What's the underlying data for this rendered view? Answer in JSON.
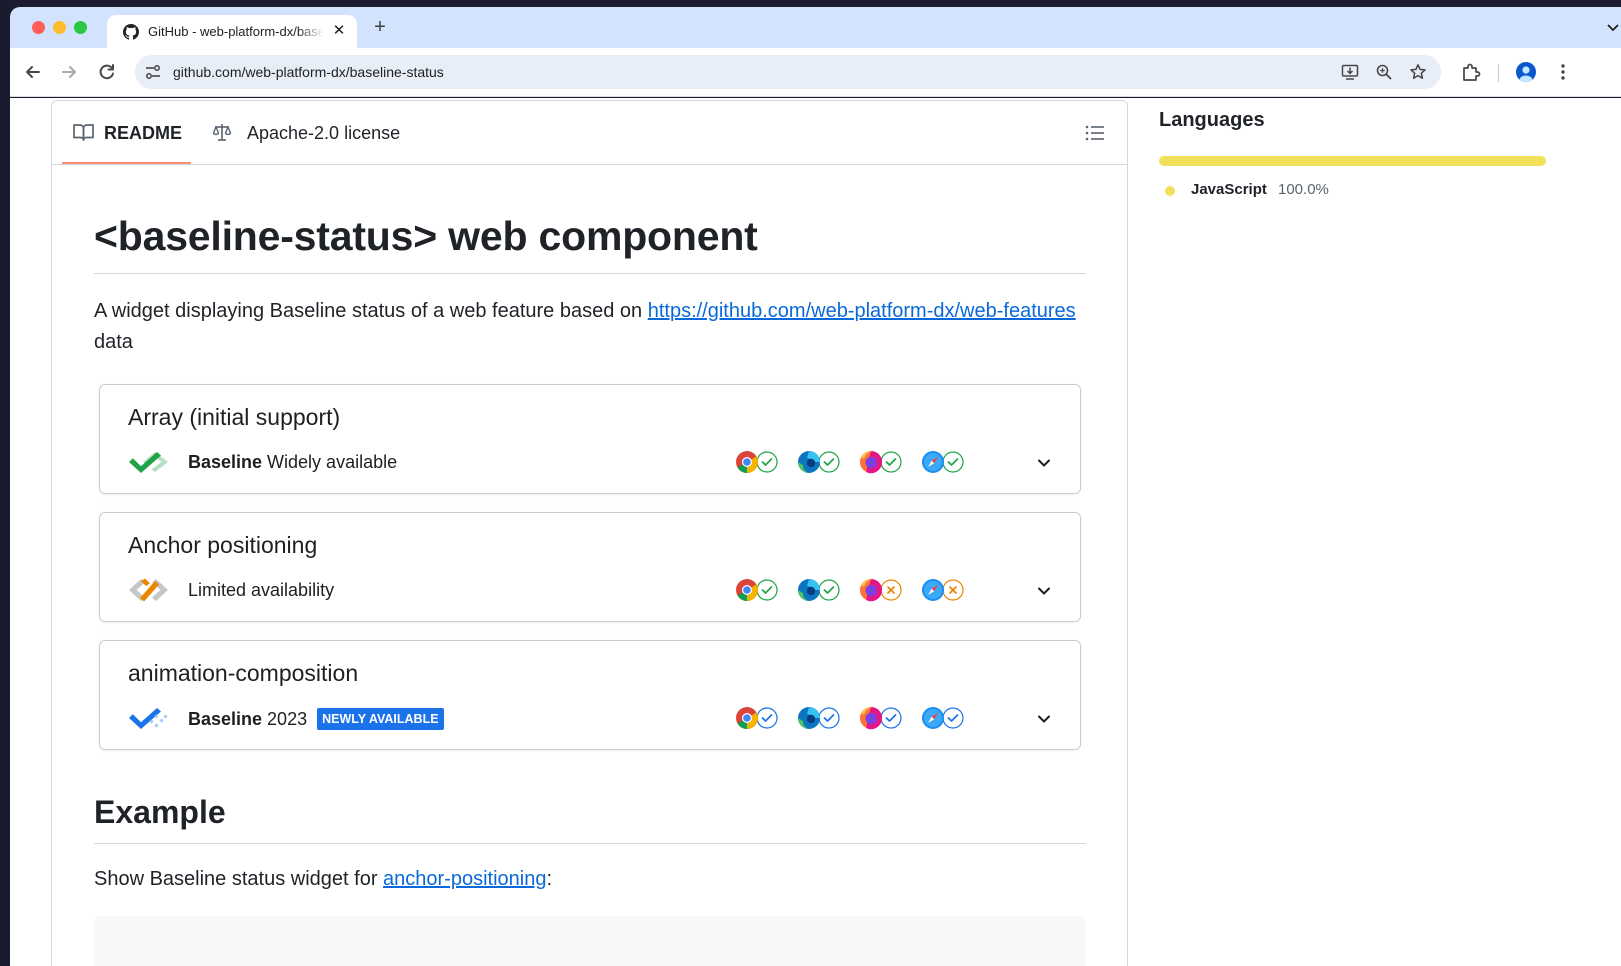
{
  "browser": {
    "tab": {
      "title": "GitHub - web-platform-dx/baseline-status",
      "close_glyph": "✕"
    },
    "new_tab_glyph": "+",
    "url": "github.com/web-platform-dx/baseline-status"
  },
  "readme": {
    "tabs": [
      {
        "label": "README",
        "icon": "book-icon"
      },
      {
        "label": "Apache-2.0 license",
        "icon": "scale-icon"
      }
    ],
    "title": "<baseline-status> web component",
    "intro": {
      "text": "A widget displaying Baseline status of a web feature based on ",
      "link": "https://github.com/web-platform-dx/web-features",
      "suffix": " data"
    },
    "widgets": [
      {
        "name": "Array (initial support)",
        "status_bold": "Baseline",
        "status_rest": " Widely available",
        "badge": "",
        "support_icons": [
          "green-check",
          "green-check",
          "green-check",
          "green-check"
        ]
      },
      {
        "name": "Anchor positioning",
        "status_bold": "",
        "status_rest": "Limited availability",
        "badge": "",
        "support_icons": [
          "green-check",
          "green-check",
          "orange-cross",
          "orange-cross"
        ]
      },
      {
        "name": "animation-composition",
        "status_bold": "Baseline",
        "status_rest": " 2023",
        "badge": "NEWLY AVAILABLE",
        "support_icons": [
          "blue-check",
          "blue-check",
          "blue-check",
          "blue-check"
        ]
      }
    ],
    "example": {
      "title": "Example",
      "text": "Show Baseline status widget for ",
      "link": "anchor-positioning",
      "suffix": ":"
    }
  },
  "languages": {
    "title": "Languages",
    "items": [
      {
        "name": "JavaScript",
        "percent": "100.0%",
        "color": "#f1e05a"
      }
    ]
  },
  "colors": {
    "widely": "#1ea446",
    "limited": "#ea8600",
    "newly": "#1a73e8",
    "link": "#0969da",
    "tab_underline": "#fd8c73"
  }
}
